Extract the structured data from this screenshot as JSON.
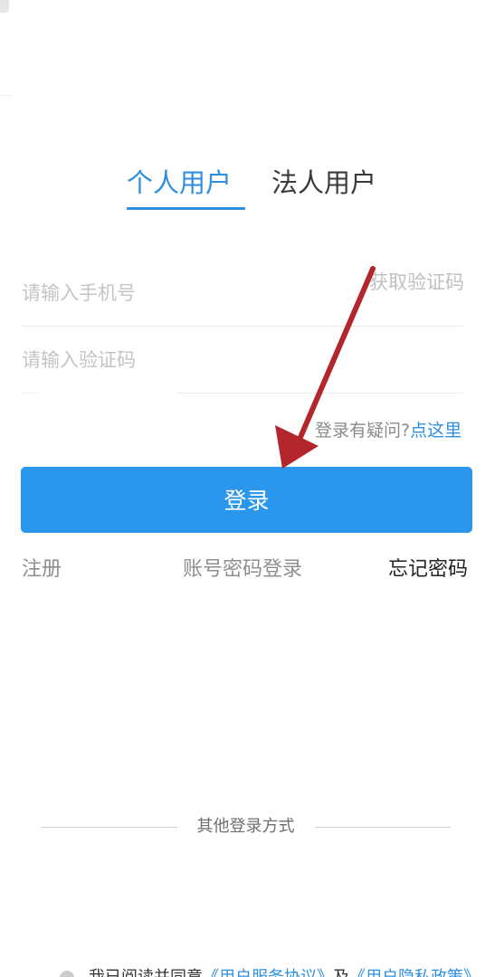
{
  "tabs": {
    "personal": "个人用户",
    "legal": "法人用户"
  },
  "form": {
    "phone_placeholder": "请输入手机号",
    "code_placeholder": "请输入验证码",
    "get_code": "获取验证码"
  },
  "help": {
    "question": "登录有疑问?",
    "link": "点这里"
  },
  "login_button": "登录",
  "links": {
    "register": "注册",
    "account_login": "账号密码登录",
    "forgot": "忘记密码"
  },
  "other_login": "其他登录方式",
  "agreement": {
    "prefix": "我已阅读并同意",
    "terms": "《用户服务协议》",
    "and": "及",
    "privacy": "《用户隐私政策》"
  },
  "colors": {
    "accent": "#2e8fe0",
    "button": "#2b97ec",
    "arrow": "#b3262b"
  }
}
